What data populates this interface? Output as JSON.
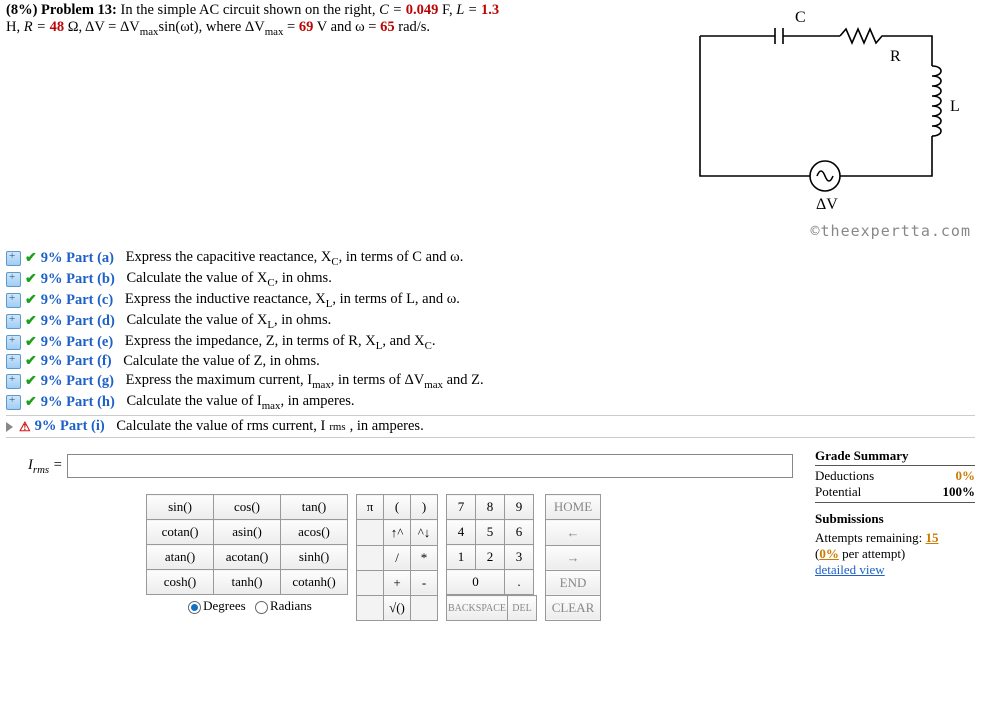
{
  "problem": {
    "weight": "(8%)",
    "label": "Problem 13:",
    "text1": "In the simple AC circuit shown on the right,",
    "C_lbl": "C =",
    "C_val": "0.049",
    "C_unit": "F,",
    "L_lbl": "L =",
    "L_val": "1.3",
    "line2a": "H,",
    "R_lbl": "R =",
    "R_val": "48",
    "R_unit": "Ω,",
    "dv_eq": "ΔV = ΔV",
    "dv_sub": "max",
    "sin": "sin(ωt), where ΔV",
    "eq69": " = ",
    "Vmax": "69",
    "Vmax_unit": "V and ω =",
    "omega": "65",
    "omega_unit": "rad/s."
  },
  "circuit": {
    "C": "C",
    "R": "R",
    "L": "L",
    "dV": "ΔV"
  },
  "copyright": "©theexpertta.com",
  "parts": [
    {
      "pct": "9%",
      "lbl": "Part (a)",
      "txt": "Express the capacitive reactance, X",
      "sub": "C",
      "tail": ", in terms of C and ω."
    },
    {
      "pct": "9%",
      "lbl": "Part (b)",
      "txt": "Calculate the value of X",
      "sub": "C",
      "tail": ", in ohms."
    },
    {
      "pct": "9%",
      "lbl": "Part (c)",
      "txt": "Express the inductive reactance, X",
      "sub": "L",
      "tail": ", in terms of L, and ω."
    },
    {
      "pct": "9%",
      "lbl": "Part (d)",
      "txt": "Calculate the value of X",
      "sub": "L",
      "tail": ", in ohms."
    },
    {
      "pct": "9%",
      "lbl": "Part (e)",
      "txt": "Express the impedance, Z, in terms of R, X",
      "sub": "L",
      "tail": ", and X"
    },
    {
      "pct": "9%",
      "lbl": "Part (f)",
      "txt": "Calculate the value of Z, in ohms.",
      "sub": "",
      "tail": ""
    },
    {
      "pct": "9%",
      "lbl": "Part (g)",
      "txt": "Express the maximum current, I",
      "sub": "max",
      "tail": ", in terms of ΔV"
    },
    {
      "pct": "9%",
      "lbl": "Part (h)",
      "txt": "Calculate the value of I",
      "sub": "max",
      "tail": ", in amperes."
    }
  ],
  "parts_extra": {
    "e_sub2": "C",
    "e_tail2": ".",
    "g_sub2": "max",
    "g_tail2": " and Z."
  },
  "current": {
    "pct": "9%",
    "lbl": "Part (i)",
    "txt": "Calculate the value of rms current, I",
    "sub": "rms",
    "tail": ", in amperes."
  },
  "answer": {
    "lhs_var": "I",
    "lhs_sub": "rms",
    "eq": " = ",
    "value": ""
  },
  "keypad": {
    "fn": [
      [
        "sin()",
        "cos()",
        "tan()"
      ],
      [
        "cotan()",
        "asin()",
        "acos()"
      ],
      [
        "atan()",
        "acotan()",
        "sinh()"
      ],
      [
        "cosh()",
        "tanh()",
        "cotanh()"
      ]
    ],
    "deg": "Degrees",
    "rad": "Radians",
    "sym": [
      [
        "π",
        "(",
        ")"
      ],
      [
        "",
        "↑^",
        "^↓"
      ],
      [
        "",
        "/",
        "*"
      ],
      [
        "",
        "+",
        "-"
      ],
      [
        "",
        "√()",
        ""
      ]
    ],
    "num": [
      [
        "7",
        "8",
        "9"
      ],
      [
        "4",
        "5",
        "6"
      ],
      [
        "1",
        "2",
        "3"
      ],
      [
        "0",
        "0",
        "."
      ]
    ],
    "bsp": "BACKSPACE",
    "del": "DEL",
    "act": [
      "HOME",
      "←",
      "→",
      "END",
      "CLEAR"
    ]
  },
  "grade": {
    "title": "Grade Summary",
    "ded_lbl": "Deductions",
    "ded_val": "0%",
    "pot_lbl": "Potential",
    "pot_val": "100%",
    "sub_title": "Submissions",
    "att_lbl": "Attempts remaining: ",
    "att_val": "15",
    "per_lbl": "(",
    "per_val": "0%",
    "per_tail": " per attempt)",
    "detail": "detailed view"
  }
}
